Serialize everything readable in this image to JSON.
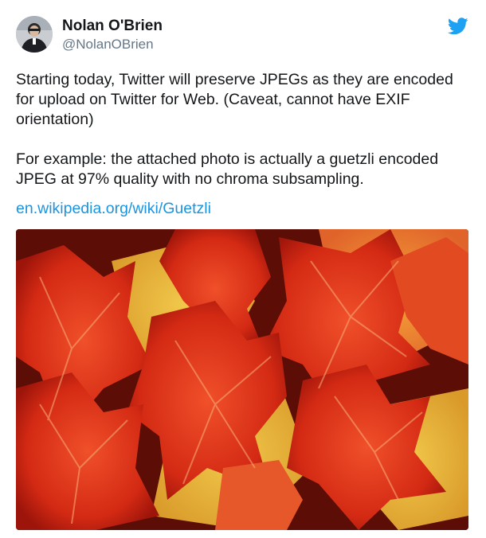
{
  "user": {
    "display_name": "Nolan O'Brien",
    "handle": "@NolanOBrien",
    "avatar_icon": "user-avatar-photo"
  },
  "brand": {
    "icon": "twitter-bird-icon",
    "color": "#1da1f2"
  },
  "tweet": {
    "text": "Starting today, Twitter will preserve JPEGs as they are encoded\nfor upload on Twitter for Web. (Caveat, cannot have EXIF\norientation)\n\nFor example: the attached photo is actually a guetzli encoded\nJPEG at 97% quality with no chroma subsampling.",
    "link_text": "en.wikipedia.org/wiki/Guetzli",
    "link_color": "#1b95e0"
  },
  "media": {
    "icon": "autumn-leaves-photo"
  }
}
